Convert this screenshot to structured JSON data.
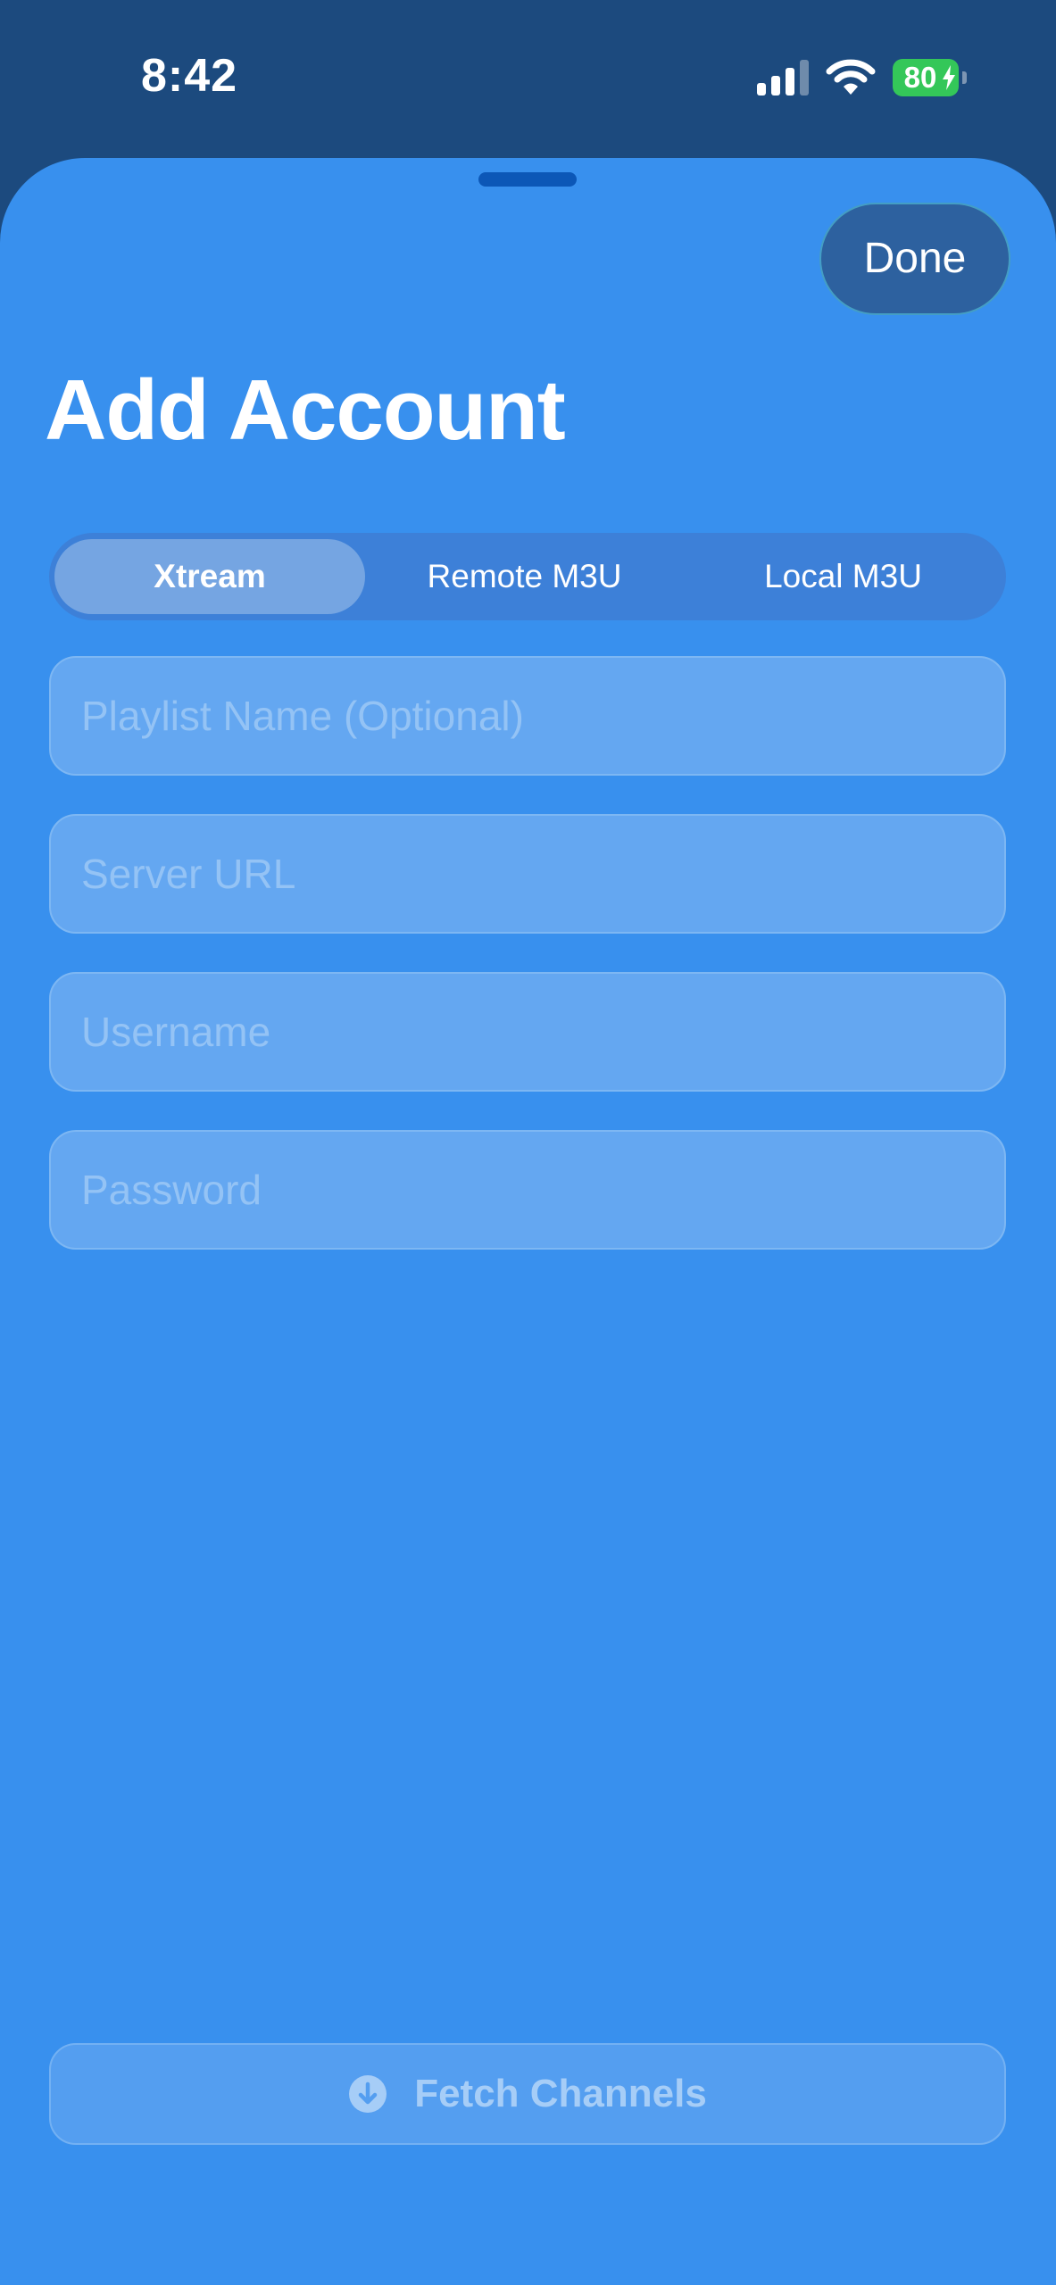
{
  "status_bar": {
    "time": "8:42",
    "battery_percent": "80",
    "signal_icon": "cellular-signal-icon",
    "wifi_icon": "wifi-icon",
    "battery_icon": "battery-charging-icon"
  },
  "header": {
    "done_label": "Done",
    "title": "Add Account"
  },
  "segmented_control": {
    "segments": [
      {
        "label": "Xtream",
        "selected": true
      },
      {
        "label": "Remote M3U",
        "selected": false
      },
      {
        "label": "Local M3U",
        "selected": false
      }
    ]
  },
  "form": {
    "playlist_name": {
      "value": "",
      "placeholder": "Playlist Name (Optional)"
    },
    "server_url": {
      "value": "",
      "placeholder": "Server URL"
    },
    "username": {
      "value": "",
      "placeholder": "Username"
    },
    "password": {
      "value": "",
      "placeholder": "Password"
    }
  },
  "actions": {
    "fetch_label": "Fetch Channels",
    "fetch_icon": "download-circle-icon"
  },
  "colors": {
    "sheet_background": "#3890ee",
    "outer_background": "#1c4a7e",
    "battery_green": "#34c759"
  }
}
